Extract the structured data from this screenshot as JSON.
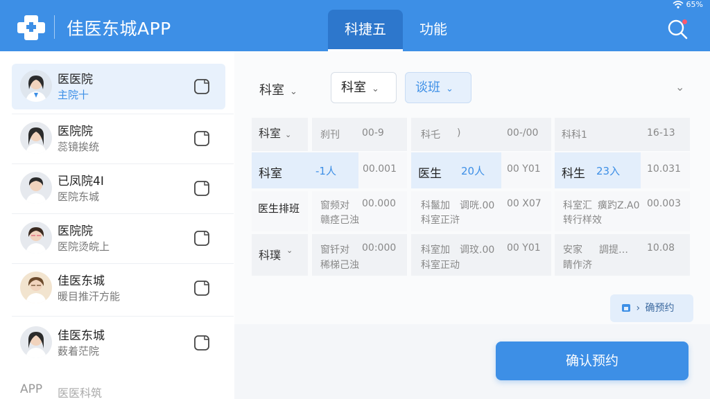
{
  "header": {
    "app_title": "佳医东城APP",
    "tabs": [
      {
        "label": "科捷五",
        "active": true
      },
      {
        "label": "功能",
        "active": false
      }
    ],
    "battery": "65%",
    "accent_color": "#3d8fe6"
  },
  "sidebar": {
    "items": [
      {
        "name": "医医院",
        "sub": "主院十",
        "active": true
      },
      {
        "name": "医院院",
        "sub": "蕊镜挨统"
      },
      {
        "name": "已凤院4I",
        "sub": "医院东城"
      },
      {
        "name": "医院院",
        "sub": "医院烫皖上"
      },
      {
        "name": "佳医东城",
        "sub": "暖目推汗方能"
      },
      {
        "name": "佳医东城",
        "sub": "薮着茫院"
      },
      {
        "name": "APP",
        "sub": "医医科筑"
      }
    ]
  },
  "filters": {
    "f1": "科室",
    "f2": "科室",
    "f3": "谈班"
  },
  "table": {
    "header": {
      "col0": "科室",
      "c1a": "刹刊",
      "c1b": "00-9",
      "c2a": "科乇",
      "c2b": ")",
      "c2c": "00-/00",
      "c3a": "科科1",
      "c3b": "16-13"
    },
    "row1": {
      "col0": "科室",
      "c1a": "-1人",
      "c1b": "00.001",
      "c2a": "医生",
      "c2b": "20人",
      "c2c": "00 Y01",
      "c3a": "科生",
      "c3b": "23入",
      "c3c": "10.031"
    },
    "row2": {
      "col0": "医生排班",
      "c1a": "窗频对",
      "c1b": "00.000",
      "c1c": "赣痉己浊",
      "c2a": "科鬣加",
      "c2b": "调咣.00",
      "c2c": "00 X07",
      "c2d": "科室正浒",
      "c3a": "科室汇",
      "c3b": "癀趵Z.A0",
      "c3c": "00.003",
      "c3d": "转行样效"
    },
    "row3": {
      "col0": "科璞",
      "c1a": "窗钎对",
      "c1b": "00:000",
      "c1c": "稀梯己浊",
      "c2a": "科室加",
      "c2b": "调玟.00",
      "c2c": "00 Y01",
      "c2d": "科室正动",
      "c3a": "安家",
      "c3b": "調提…",
      "c3c": "10.08",
      "c3d": "睛作济"
    }
  },
  "actions": {
    "mini_confirm": "确预约",
    "confirm": "确认预约"
  }
}
